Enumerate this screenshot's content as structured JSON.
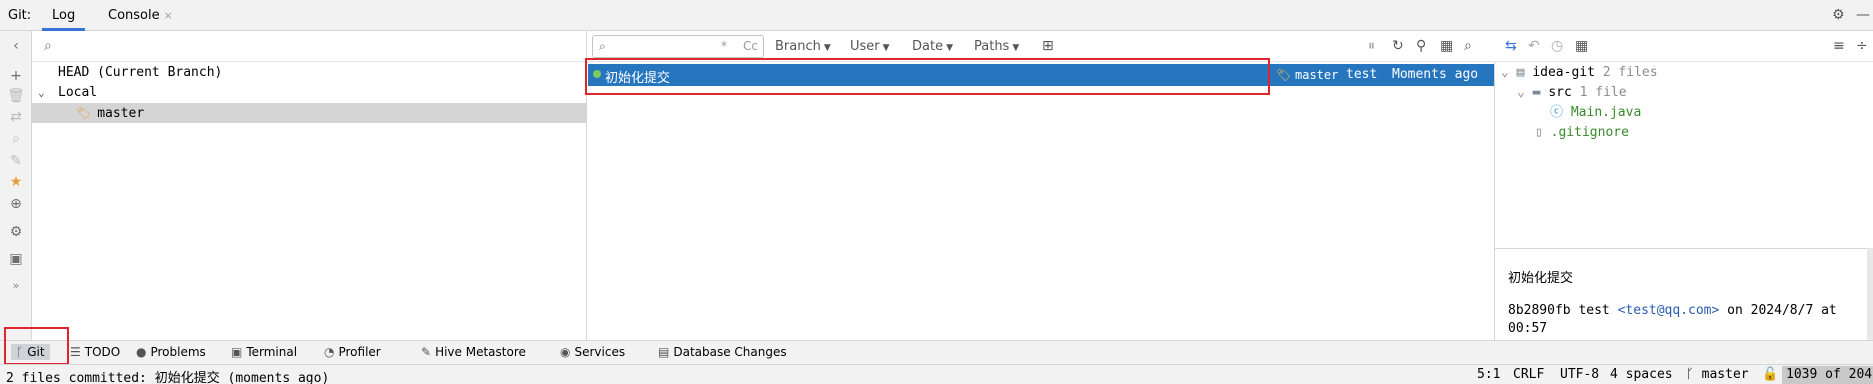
{
  "tabbar": {
    "label": "Git:",
    "tabs": [
      {
        "label": "Log"
      },
      {
        "label": "Console"
      }
    ],
    "close_glyph": "×",
    "right_icons": [
      "gear-icon",
      "minimize-icon"
    ]
  },
  "left_strip": {
    "icons": [
      "chevron-left-icon",
      "add-icon",
      "delete-icon",
      "merge-icon",
      "search-icon",
      "edit-icon",
      "star-icon",
      "target-icon",
      "settings-icon",
      "terminal-icon"
    ],
    "overflow": "»"
  },
  "branches": {
    "search_placeholder": "",
    "head": "HEAD (Current Branch)",
    "local": "Local",
    "branch": "master"
  },
  "commit_toolbar": {
    "search_placeholder": "",
    "regex_glyph": "*",
    "case_glyph": "Cc",
    "filters": [
      {
        "label": "Branch"
      },
      {
        "label": "User"
      },
      {
        "label": "Date"
      },
      {
        "label": "Paths"
      }
    ]
  },
  "commits": [
    {
      "message": "初始化提交",
      "refs": "master",
      "author": "test",
      "date": "Moments ago"
    }
  ],
  "changes": {
    "root": {
      "name": "idea-git",
      "count": "2 files"
    },
    "src": {
      "name": "src",
      "count": "1 file"
    },
    "files": [
      {
        "name": "Main.java"
      },
      {
        "name": ".gitignore"
      }
    ]
  },
  "details": {
    "subject": "初始化提交",
    "hash": "8b2890fb",
    "author": "test",
    "email": "<test@qq.com>",
    "on": "on",
    "date": "2024/8/7",
    "at": "at",
    "time": "00:57"
  },
  "tool_windows": [
    {
      "label": "Git",
      "icon": "branch-icon"
    },
    {
      "label": "TODO",
      "icon": "list-icon"
    },
    {
      "label": "Problems",
      "icon": "info-icon"
    },
    {
      "label": "Terminal",
      "icon": "terminal-icon"
    },
    {
      "label": "Profiler",
      "icon": "profiler-icon"
    },
    {
      "label": "Hive Metastore",
      "icon": "hive-icon"
    },
    {
      "label": "Services",
      "icon": "services-icon"
    },
    {
      "label": "Database Changes",
      "icon": "database-icon"
    }
  ],
  "status_bar": {
    "message": "2 files committed: 初始化提交 (moments ago)",
    "position": "5:1",
    "line_sep": "CRLF",
    "encoding": "UTF-8",
    "indent": "4 spaces",
    "branch": "master",
    "memory": "1039 of 204"
  },
  "colors": {
    "accent": "#2675bf",
    "highlight_box": "#e0252c",
    "selected_branch": "#d5d5d5",
    "added_file": "#3a8a2c"
  }
}
